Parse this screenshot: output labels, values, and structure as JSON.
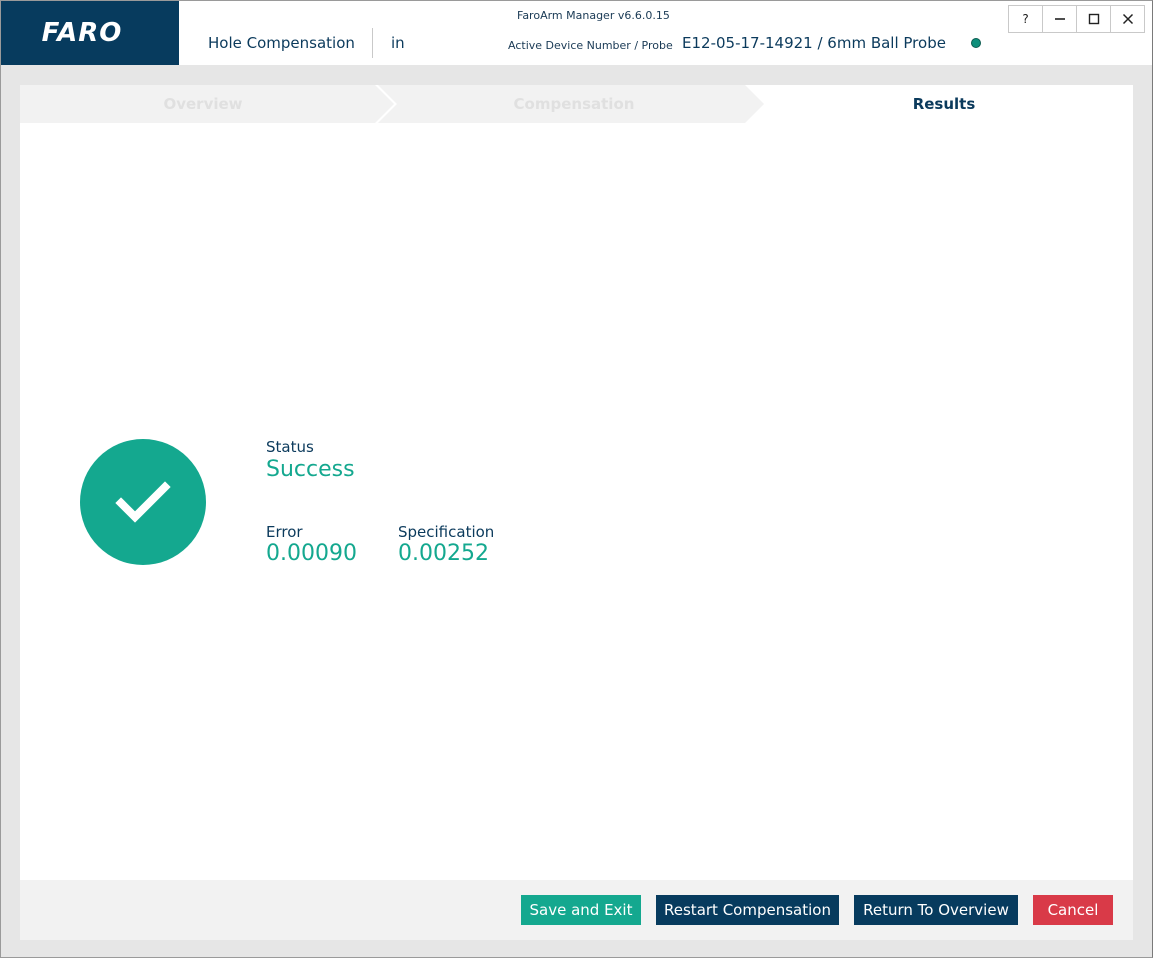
{
  "app": {
    "version": "FaroArm Manager v6.6.0.15",
    "logo": "FARO",
    "module_title": "Hole Compensation",
    "units": "in",
    "device_label": "Active Device Number / Probe",
    "device_value": "E12-05-17-14921 / 6mm Ball Probe",
    "status_dot_color": "#0e8f7b"
  },
  "window_buttons": {
    "help": "?",
    "minimize": "minimize-icon",
    "maximize": "maximize-icon",
    "close": "close-icon"
  },
  "steps": [
    {
      "label": "Overview",
      "state": "inactive"
    },
    {
      "label": "Compensation",
      "state": "inactive"
    },
    {
      "label": "Results",
      "state": "active"
    }
  ],
  "results": {
    "status_label": "Status",
    "status_value": "Success",
    "error_label": "Error",
    "error_value": "0.00090",
    "spec_label": "Specification",
    "spec_value": "0.00252",
    "icon": "checkmark-icon",
    "accent_color": "#14a88f"
  },
  "footer": {
    "save_exit": "Save and Exit",
    "restart": "Restart Compensation",
    "return_overview": "Return To Overview",
    "cancel": "Cancel"
  },
  "colors": {
    "navy": "#073b5e",
    "green": "#14a88f",
    "red": "#d93a48"
  }
}
